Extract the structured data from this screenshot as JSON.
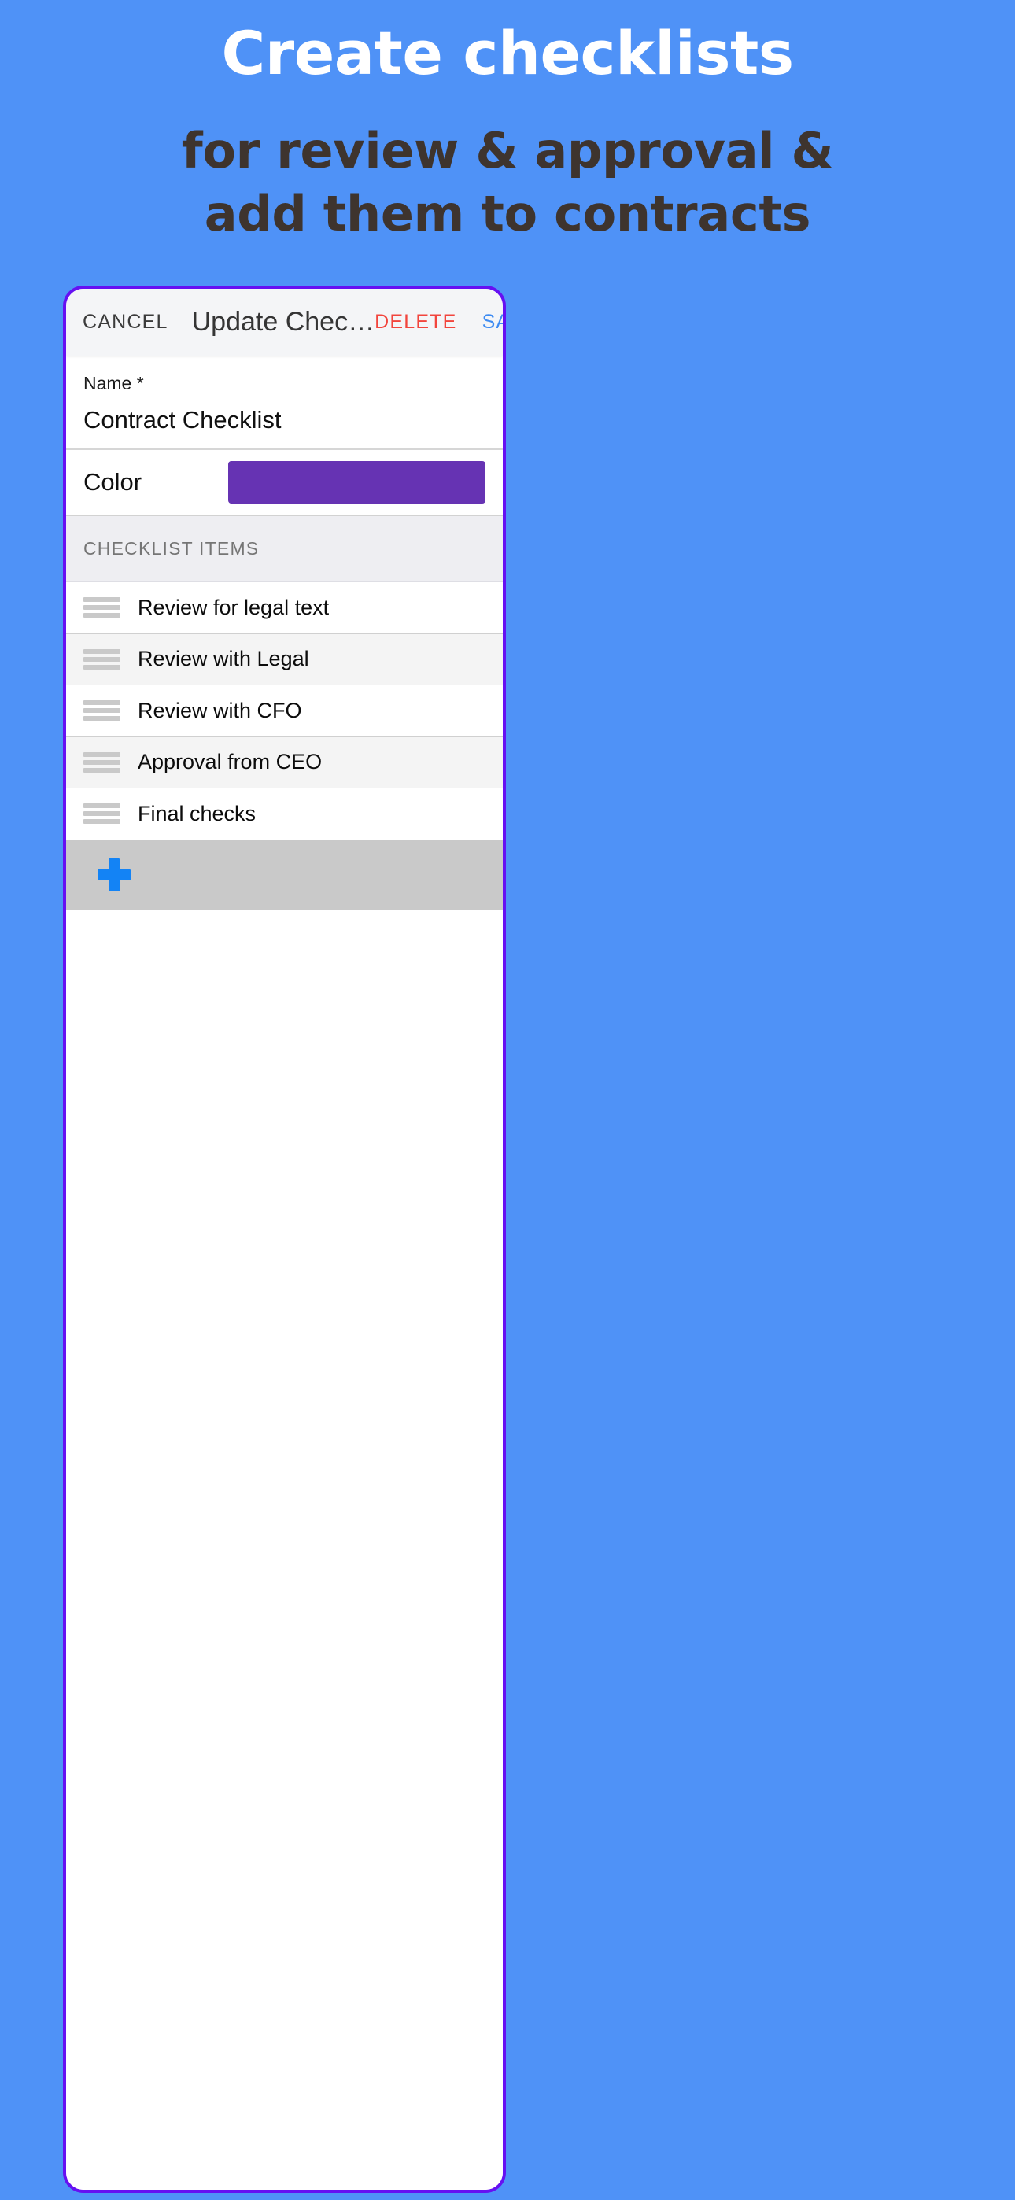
{
  "promo": {
    "line1": "Create checklists",
    "line2": "for review & approval &",
    "line3": "add them to contracts",
    "line1_color": "#ffffff",
    "line2_color": "#3e342e",
    "background_color": "#4f92f7"
  },
  "phone": {
    "frame_color": "#6610f2"
  },
  "appbar": {
    "cancel_label": "CANCEL",
    "title": "Update Chec…",
    "delete_label": "DELETE",
    "save_label": "SAVE",
    "delete_color": "#f2453d",
    "save_color": "#3d8bf2"
  },
  "form": {
    "name_label": "Name *",
    "name_value": "Contract Checklist",
    "color_label": "Color",
    "color_value": "#6633b3"
  },
  "checklist": {
    "section_title": "CHECKLIST ITEMS",
    "items": [
      {
        "label": "Review for legal text"
      },
      {
        "label": "Review with Legal"
      },
      {
        "label": "Review with CFO"
      },
      {
        "label": "Approval from CEO"
      },
      {
        "label": "Final checks"
      }
    ],
    "add_icon": "plus-icon",
    "add_icon_color": "#1383f5"
  }
}
